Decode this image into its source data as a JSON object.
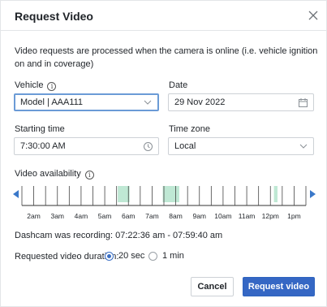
{
  "dialog": {
    "title": "Request Video"
  },
  "info_text": "Video requests are processed when the camera is online (i.e. vehicle ignition on and in coverage)",
  "vehicle": {
    "label": "Vehicle",
    "value": "Model | AAA111"
  },
  "date": {
    "label": "Date",
    "value": "29 Nov 2022"
  },
  "starting_time": {
    "label": "Starting time",
    "value": "7:30:00 AM"
  },
  "time_zone": {
    "label": "Time zone",
    "value": "Local"
  },
  "availability": {
    "label": "Video availability",
    "ticks": [
      "2am",
      "3am",
      "4am",
      "5am",
      "6am",
      "7am",
      "8am",
      "9am",
      "10am",
      "11am",
      "12pm",
      "1pm"
    ],
    "available_color": "#bfe8d4",
    "available_ranges_hours": [
      [
        5.55,
        6.05
      ],
      [
        7.45,
        8.15
      ],
      [
        12.15,
        12.3
      ]
    ]
  },
  "recording_text": "Dashcam was recording: 07:22:36 am - 07:59:40 am",
  "duration": {
    "label": "Requested video duration:",
    "options": [
      "20 sec",
      "1 min"
    ],
    "selected": "20 sec"
  },
  "buttons": {
    "cancel": "Cancel",
    "submit": "Request video"
  },
  "colors": {
    "accent": "#3567c4",
    "focus_border": "#6b9bd6"
  }
}
